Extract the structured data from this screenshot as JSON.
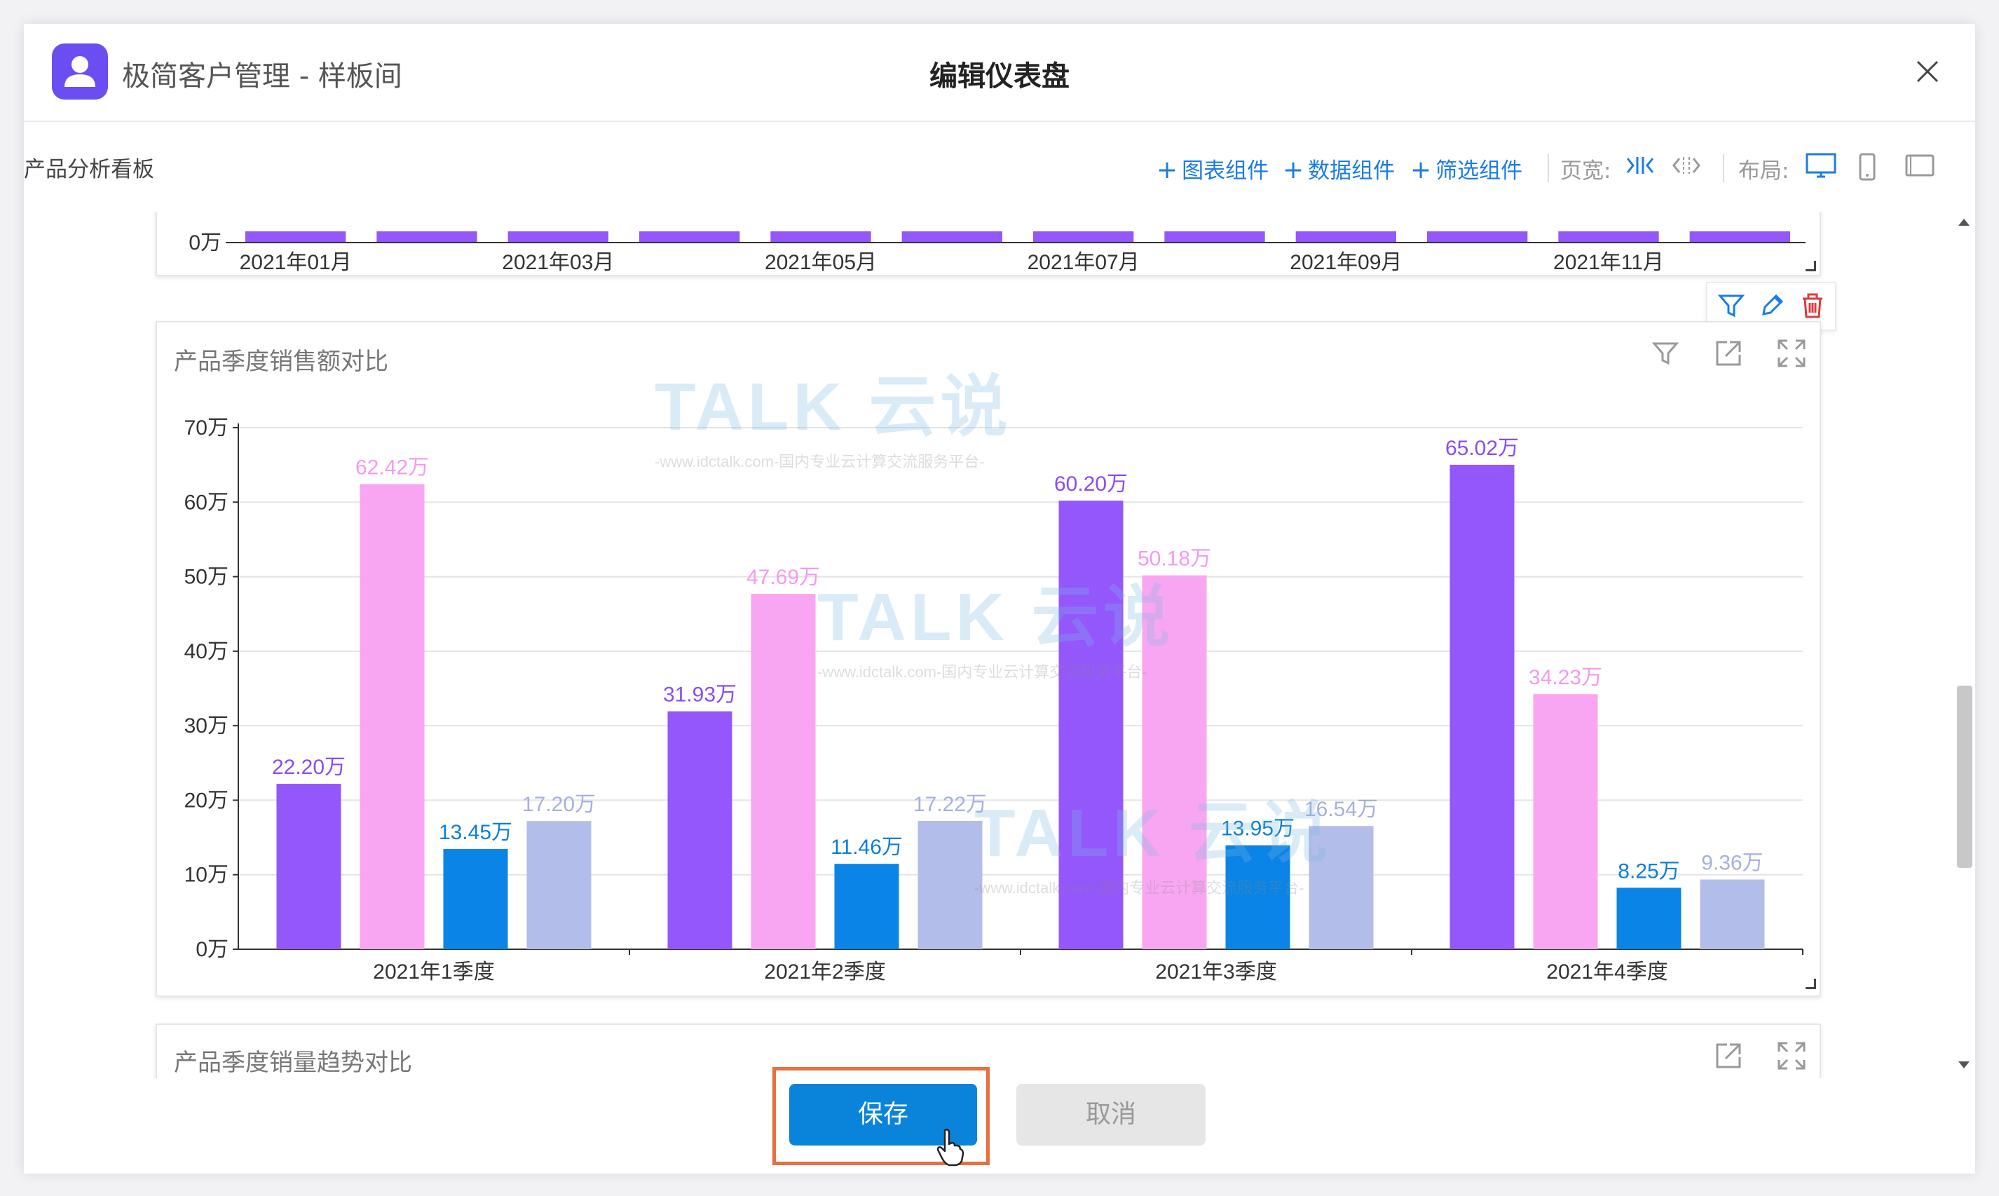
{
  "header": {
    "app_title": "极简客户管理 - 样板间",
    "dialog_title": "编辑仪表盘"
  },
  "toolbar": {
    "board_name": "产品分析看板",
    "add_chart": "图表组件",
    "add_data": "数据组件",
    "add_filter": "筛选组件",
    "page_width_label": "页宽:",
    "layout_label": "布局:"
  },
  "top_card": {
    "x_ticks": [
      "2021年01月",
      "2021年03月",
      "2021年05月",
      "2021年07月",
      "2021年09月",
      "2021年11月"
    ],
    "y_zero": "0万"
  },
  "chart_card": {
    "title": "产品季度销售额对比"
  },
  "next_card": {
    "title": "产品季度销量趋势对比"
  },
  "watermark": {
    "brand": "TALK 云说",
    "slogan": "-www.idctalk.com-国内专业云计算交流服务平台-"
  },
  "footer": {
    "save_label": "保存",
    "cancel_label": "取消"
  },
  "colors": {
    "series": [
      "#9457fb",
      "#f9a6f2",
      "#0a84e6",
      "#b3bde9"
    ],
    "label_colors": [
      "#8a4cf5",
      "#f59af0",
      "#0a7fd8",
      "#a6b0e0"
    ],
    "accent": "#0a84da",
    "highlight_frame": "#e8703f"
  },
  "chart_data": {
    "type": "bar",
    "title": "产品季度销售额对比",
    "categories": [
      "2021年1季度",
      "2021年2季度",
      "2021年3季度",
      "2021年4季度"
    ],
    "series": [
      {
        "values": [
          22.2,
          31.93,
          60.2,
          65.02
        ]
      },
      {
        "values": [
          62.42,
          47.69,
          50.18,
          34.23
        ]
      },
      {
        "values": [
          13.45,
          11.46,
          13.95,
          8.25
        ]
      },
      {
        "values": [
          17.2,
          17.22,
          16.54,
          9.36
        ]
      }
    ],
    "value_labels": [
      [
        "22.20万",
        "31.93万",
        "60.20万",
        "65.02万"
      ],
      [
        "62.42万",
        "47.69万",
        "50.18万",
        "34.23万"
      ],
      [
        "13.45万",
        "11.46万",
        "13.95万",
        "8.25万"
      ],
      [
        "17.20万",
        "17.22万",
        "16.54万",
        "9.36万"
      ]
    ],
    "y_ticks": [
      "0万",
      "10万",
      "20万",
      "30万",
      "40万",
      "50万",
      "60万",
      "70万"
    ],
    "ylim": [
      0,
      70
    ],
    "grid": true,
    "legend": "none"
  }
}
